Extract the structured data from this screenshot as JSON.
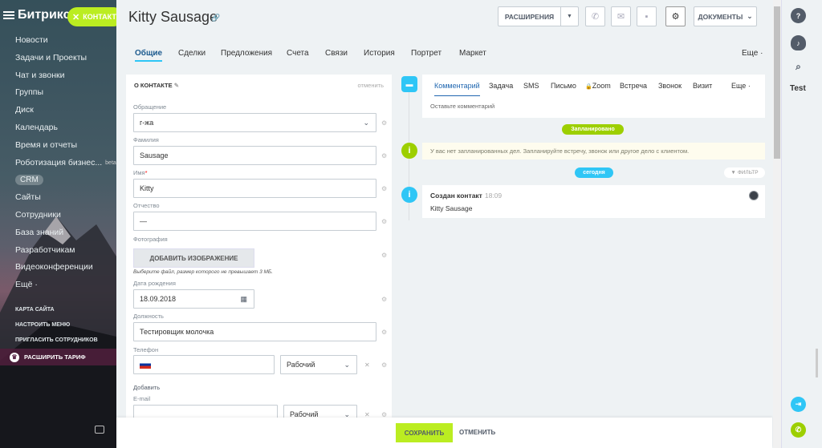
{
  "sidebar": {
    "logo": "Битрикс",
    "contact_button": "КОНТАКТ",
    "items": [
      "Новости",
      "Задачи и Проекты",
      "Чат и звонки",
      "Группы",
      "Диск",
      "Календарь",
      "Время и отчеты",
      "Роботизация бизнес...",
      "CRM",
      "Сайты",
      "Сотрудники",
      "База знаний",
      "Разработчикам",
      "Видеоконференции",
      "Ещё ·"
    ],
    "beta": "beta",
    "small_links": [
      "КАРТА САЙТА",
      "НАСТРОИТЬ МЕНЮ",
      "ПРИГЛАСИТЬ СОТРУДНИКОВ"
    ],
    "upgrade": "РАСШИРИТЬ ТАРИФ"
  },
  "header": {
    "title": "Kitty Sausage",
    "extensions": "РАСШИРЕНИЯ",
    "documents": "ДОКУМЕНТЫ"
  },
  "tabs": [
    "Общие",
    "Сделки",
    "Предложения",
    "Счета",
    "Связи",
    "История",
    "Портрет",
    "Маркет"
  ],
  "tabs_more": "Еще ·",
  "form": {
    "heading": "О КОНТАКТЕ",
    "cancel": "отменить",
    "salutation_label": "Обращение",
    "salutation_value": "г-жа",
    "lastname_label": "Фамилия",
    "lastname_value": "Sausage",
    "firstname_label": "Имя",
    "firstname_value": "Kitty",
    "middlename_label": "Отчество",
    "middlename_value": "—",
    "photo_label": "Фотография",
    "add_image": "ДОБАВИТЬ ИЗОБРАЖЕНИЕ",
    "photo_hint": "Выберите файл, размер которого не превышает 3 МБ.",
    "birthday_label": "Дата рождения",
    "birthday_value": "18.09.2018",
    "position_label": "Должность",
    "position_value": "Тестировщик молочка",
    "phone_label": "Телефон",
    "phone_type": "Рабочий",
    "add_link": "Добавить",
    "email_label": "E-mail",
    "email_type": "Рабочий"
  },
  "timeline": {
    "tabs": [
      "Комментарий",
      "Задача",
      "SMS",
      "Письмо",
      "Zoom",
      "Встреча",
      "Звонок",
      "Визит"
    ],
    "more": "Еще ·",
    "placeholder": "Оставьте комментарий",
    "planned_badge": "Запланировано",
    "planned_empty": "У вас нет запланированных дел. Запланируйте встречу, звонок или другое дело с клиентом.",
    "today_badge": "сегодня",
    "filter": "ФИЛЬТР",
    "event_title": "Создан контакт",
    "event_time": "18:09",
    "event_name": "Kitty Sausage"
  },
  "footer": {
    "save": "СОХРАНИТЬ",
    "cancel": "ОТМЕНИТЬ"
  },
  "right_panel": {
    "user_label": "Test"
  },
  "colors": {
    "accent_green": "#bbed21",
    "accent_blue": "#2fc6f6",
    "info_green": "#9dcf00"
  }
}
